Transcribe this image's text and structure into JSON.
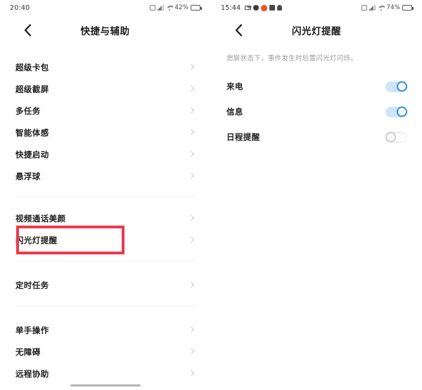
{
  "left_screen": {
    "status_bar": {
      "time": "20:40",
      "battery_percent": "42%",
      "battery_level": 42,
      "icons": [
        "sim-icon",
        "signal-icon",
        "wifi-icon",
        "battery-icon"
      ]
    },
    "nav": {
      "back_icon": "chevron-left-icon",
      "title": "快捷与辅助"
    },
    "groups": [
      {
        "items": [
          {
            "label": "超级卡包",
            "chevron": "chevron-right-icon"
          },
          {
            "label": "超级截屏",
            "chevron": "chevron-right-icon"
          },
          {
            "label": "多任务",
            "chevron": "chevron-right-icon"
          },
          {
            "label": "智能体感",
            "chevron": "chevron-right-icon"
          },
          {
            "label": "快捷启动",
            "chevron": "chevron-right-icon"
          },
          {
            "label": "悬浮球",
            "chevron": "chevron-right-icon"
          }
        ]
      },
      {
        "items": [
          {
            "label": "视频通话美颜",
            "chevron": "chevron-right-icon"
          },
          {
            "label": "闪光灯提醒",
            "chevron": "chevron-right-icon",
            "highlighted": true
          }
        ]
      },
      {
        "items": [
          {
            "label": "定时任务",
            "chevron": "chevron-right-icon"
          }
        ]
      },
      {
        "items": [
          {
            "label": "单手操作",
            "chevron": "chevron-right-icon"
          },
          {
            "label": "无障碍",
            "chevron": "chevron-right-icon"
          },
          {
            "label": "远程协助",
            "chevron": "chevron-right-icon"
          }
        ]
      }
    ],
    "highlight_color": "#ec3b50"
  },
  "right_screen": {
    "status_bar": {
      "time": "15:44",
      "battery_percent": "74%",
      "battery_level": 74,
      "notification_icons": [
        "mail-icon",
        "gear-icon",
        "flame-icon",
        "app-icon",
        "location-icon"
      ],
      "icons": [
        "sim-icon",
        "signal-icon",
        "wifi-icon",
        "battery-icon"
      ]
    },
    "nav": {
      "back_icon": "chevron-left-icon",
      "title": "闪光灯提醒"
    },
    "description": "熄屏状态下，事件发生时后置闪光灯闪烁。",
    "toggles": [
      {
        "label": "来电",
        "state": "on"
      },
      {
        "label": "信息",
        "state": "on"
      },
      {
        "label": "日程提醒",
        "state": "off"
      }
    ],
    "accent_color": "#2b8cf0"
  }
}
